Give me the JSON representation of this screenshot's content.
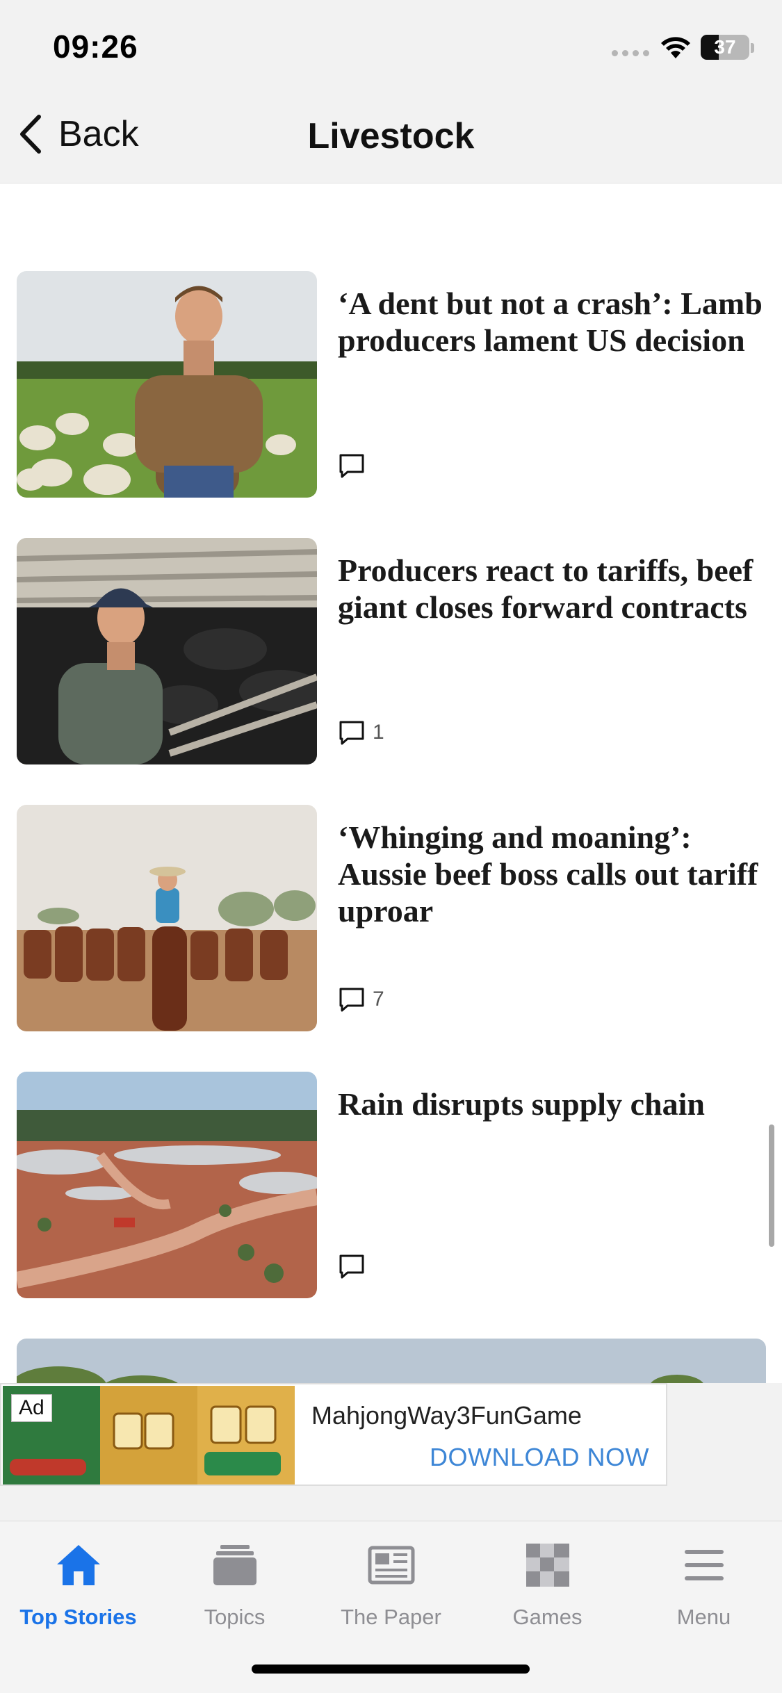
{
  "status_bar": {
    "time": "09:26",
    "battery": "37"
  },
  "nav": {
    "back_label": "Back",
    "title": "Livestock"
  },
  "articles": [
    {
      "headline": "‘A dent but not a crash’: Lamb producers lament US decision",
      "comment_count": ""
    },
    {
      "headline": "Producers react to tariffs, beef giant closes forward contracts",
      "comment_count": "1"
    },
    {
      "headline": "‘Whinging and moaning’: Aussie beef boss calls out tariff uproar",
      "comment_count": "7"
    },
    {
      "headline": "Rain disrupts supply chain",
      "comment_count": ""
    }
  ],
  "ad": {
    "badge": "Ad",
    "name": "MahjongWay3FunGame",
    "cta": "DOWNLOAD NOW"
  },
  "tabs": [
    {
      "label": "Top Stories",
      "icon": "home-icon",
      "active": true
    },
    {
      "label": "Topics",
      "icon": "topics-icon",
      "active": false
    },
    {
      "label": "The Paper",
      "icon": "newspaper-icon",
      "active": false
    },
    {
      "label": "Games",
      "icon": "games-icon",
      "active": false
    },
    {
      "label": "Menu",
      "icon": "menu-icon",
      "active": false
    }
  ],
  "colors": {
    "accent": "#1a73e8",
    "ad_cta": "#3d86d6",
    "inactive_tab": "#8e8e93"
  }
}
